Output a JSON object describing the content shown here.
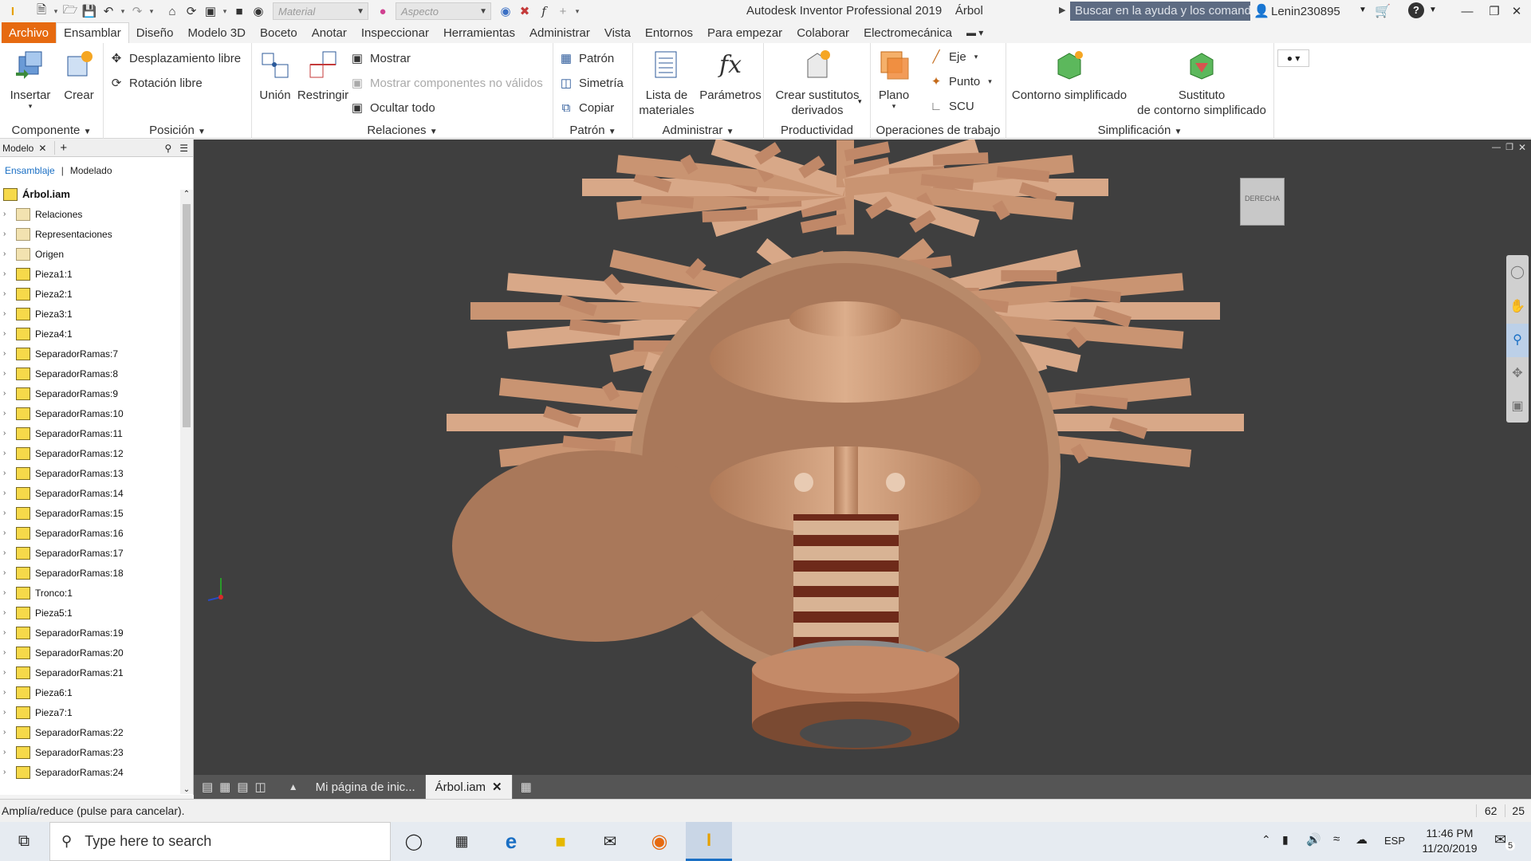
{
  "window": {
    "title": "Autodesk Inventor Professional 2019",
    "document": "Árbol",
    "help_search_placeholder": "Buscar en la ayuda y los comand",
    "user": "Lenin230895"
  },
  "quick_access": {
    "material_placeholder": "Material",
    "appearance_placeholder": "Aspecto"
  },
  "ribbon_tabs": [
    "Archivo",
    "Ensamblar",
    "Diseño",
    "Modelo 3D",
    "Boceto",
    "Anotar",
    "Inspeccionar",
    "Herramientas",
    "Administrar",
    "Vista",
    "Entornos",
    "Para empezar",
    "Colaborar",
    "Electromecánica"
  ],
  "ribbon": {
    "componente": {
      "label": "Componente",
      "insert": "Insertar",
      "create": "Crear"
    },
    "posicion": {
      "label": "Posición",
      "free_move": "Desplazamiento libre",
      "free_rotate": "Rotación libre"
    },
    "relaciones": {
      "label": "Relaciones",
      "union": "Unión",
      "constrain": "Restringir",
      "show": "Mostrar",
      "show_invalid": "Mostrar componentes no válidos",
      "hide_all": "Ocultar todo"
    },
    "patron": {
      "label": "Patrón",
      "pattern": "Patrón",
      "mirror": "Simetría",
      "copy": "Copiar"
    },
    "administrar": {
      "label": "Administrar",
      "bom_1": "Lista de",
      "bom_2": "materiales",
      "params": "Parámetros"
    },
    "productividad": {
      "label": "Productividad",
      "sub_1": "Crear sustitutos",
      "sub_2": "derivados"
    },
    "operaciones": {
      "label": "Operaciones de trabajo",
      "plane": "Plano",
      "axis": "Eje",
      "point": "Punto",
      "ucs": "SCU"
    },
    "simplificacion": {
      "label": "Simplificación",
      "shrinkwrap": "Contorno simplificado",
      "sub_1": "Sustituto",
      "sub_2": "de contorno simplificado"
    }
  },
  "browser": {
    "tab": "Modelo",
    "sub_assembly": "Ensamblaje",
    "sub_modeling": "Modelado",
    "root": "Árbol.iam",
    "items": [
      "Relaciones",
      "Representaciones",
      "Origen",
      "Pieza1:1",
      "Pieza2:1",
      "Pieza3:1",
      "Pieza4:1",
      "SeparadorRamas:7",
      "SeparadorRamas:8",
      "SeparadorRamas:9",
      "SeparadorRamas:10",
      "SeparadorRamas:11",
      "SeparadorRamas:12",
      "SeparadorRamas:13",
      "SeparadorRamas:14",
      "SeparadorRamas:15",
      "SeparadorRamas:16",
      "SeparadorRamas:17",
      "SeparadorRamas:18",
      "Tronco:1",
      "Pieza5:1",
      "SeparadorRamas:19",
      "SeparadorRamas:20",
      "SeparadorRamas:21",
      "Pieza6:1",
      "Pieza7:1",
      "SeparadorRamas:22",
      "SeparadorRamas:23",
      "SeparadorRamas:24"
    ]
  },
  "viewcube": {
    "face": "DERECHA"
  },
  "doc_tabs": [
    "Mi página de inic...",
    "Árbol.iam"
  ],
  "status": {
    "message": "Amplía/reduce (pulse para cancelar).",
    "count_a": "62",
    "count_b": "25"
  },
  "taskbar": {
    "search_placeholder": "Type here to search",
    "lang": "ESP",
    "time": "11:46 PM",
    "date": "11/20/2019",
    "notifications": "5"
  },
  "colors": {
    "accent": "#e66a10",
    "viewport": "#3f3f3f",
    "wood": "#c99472"
  }
}
